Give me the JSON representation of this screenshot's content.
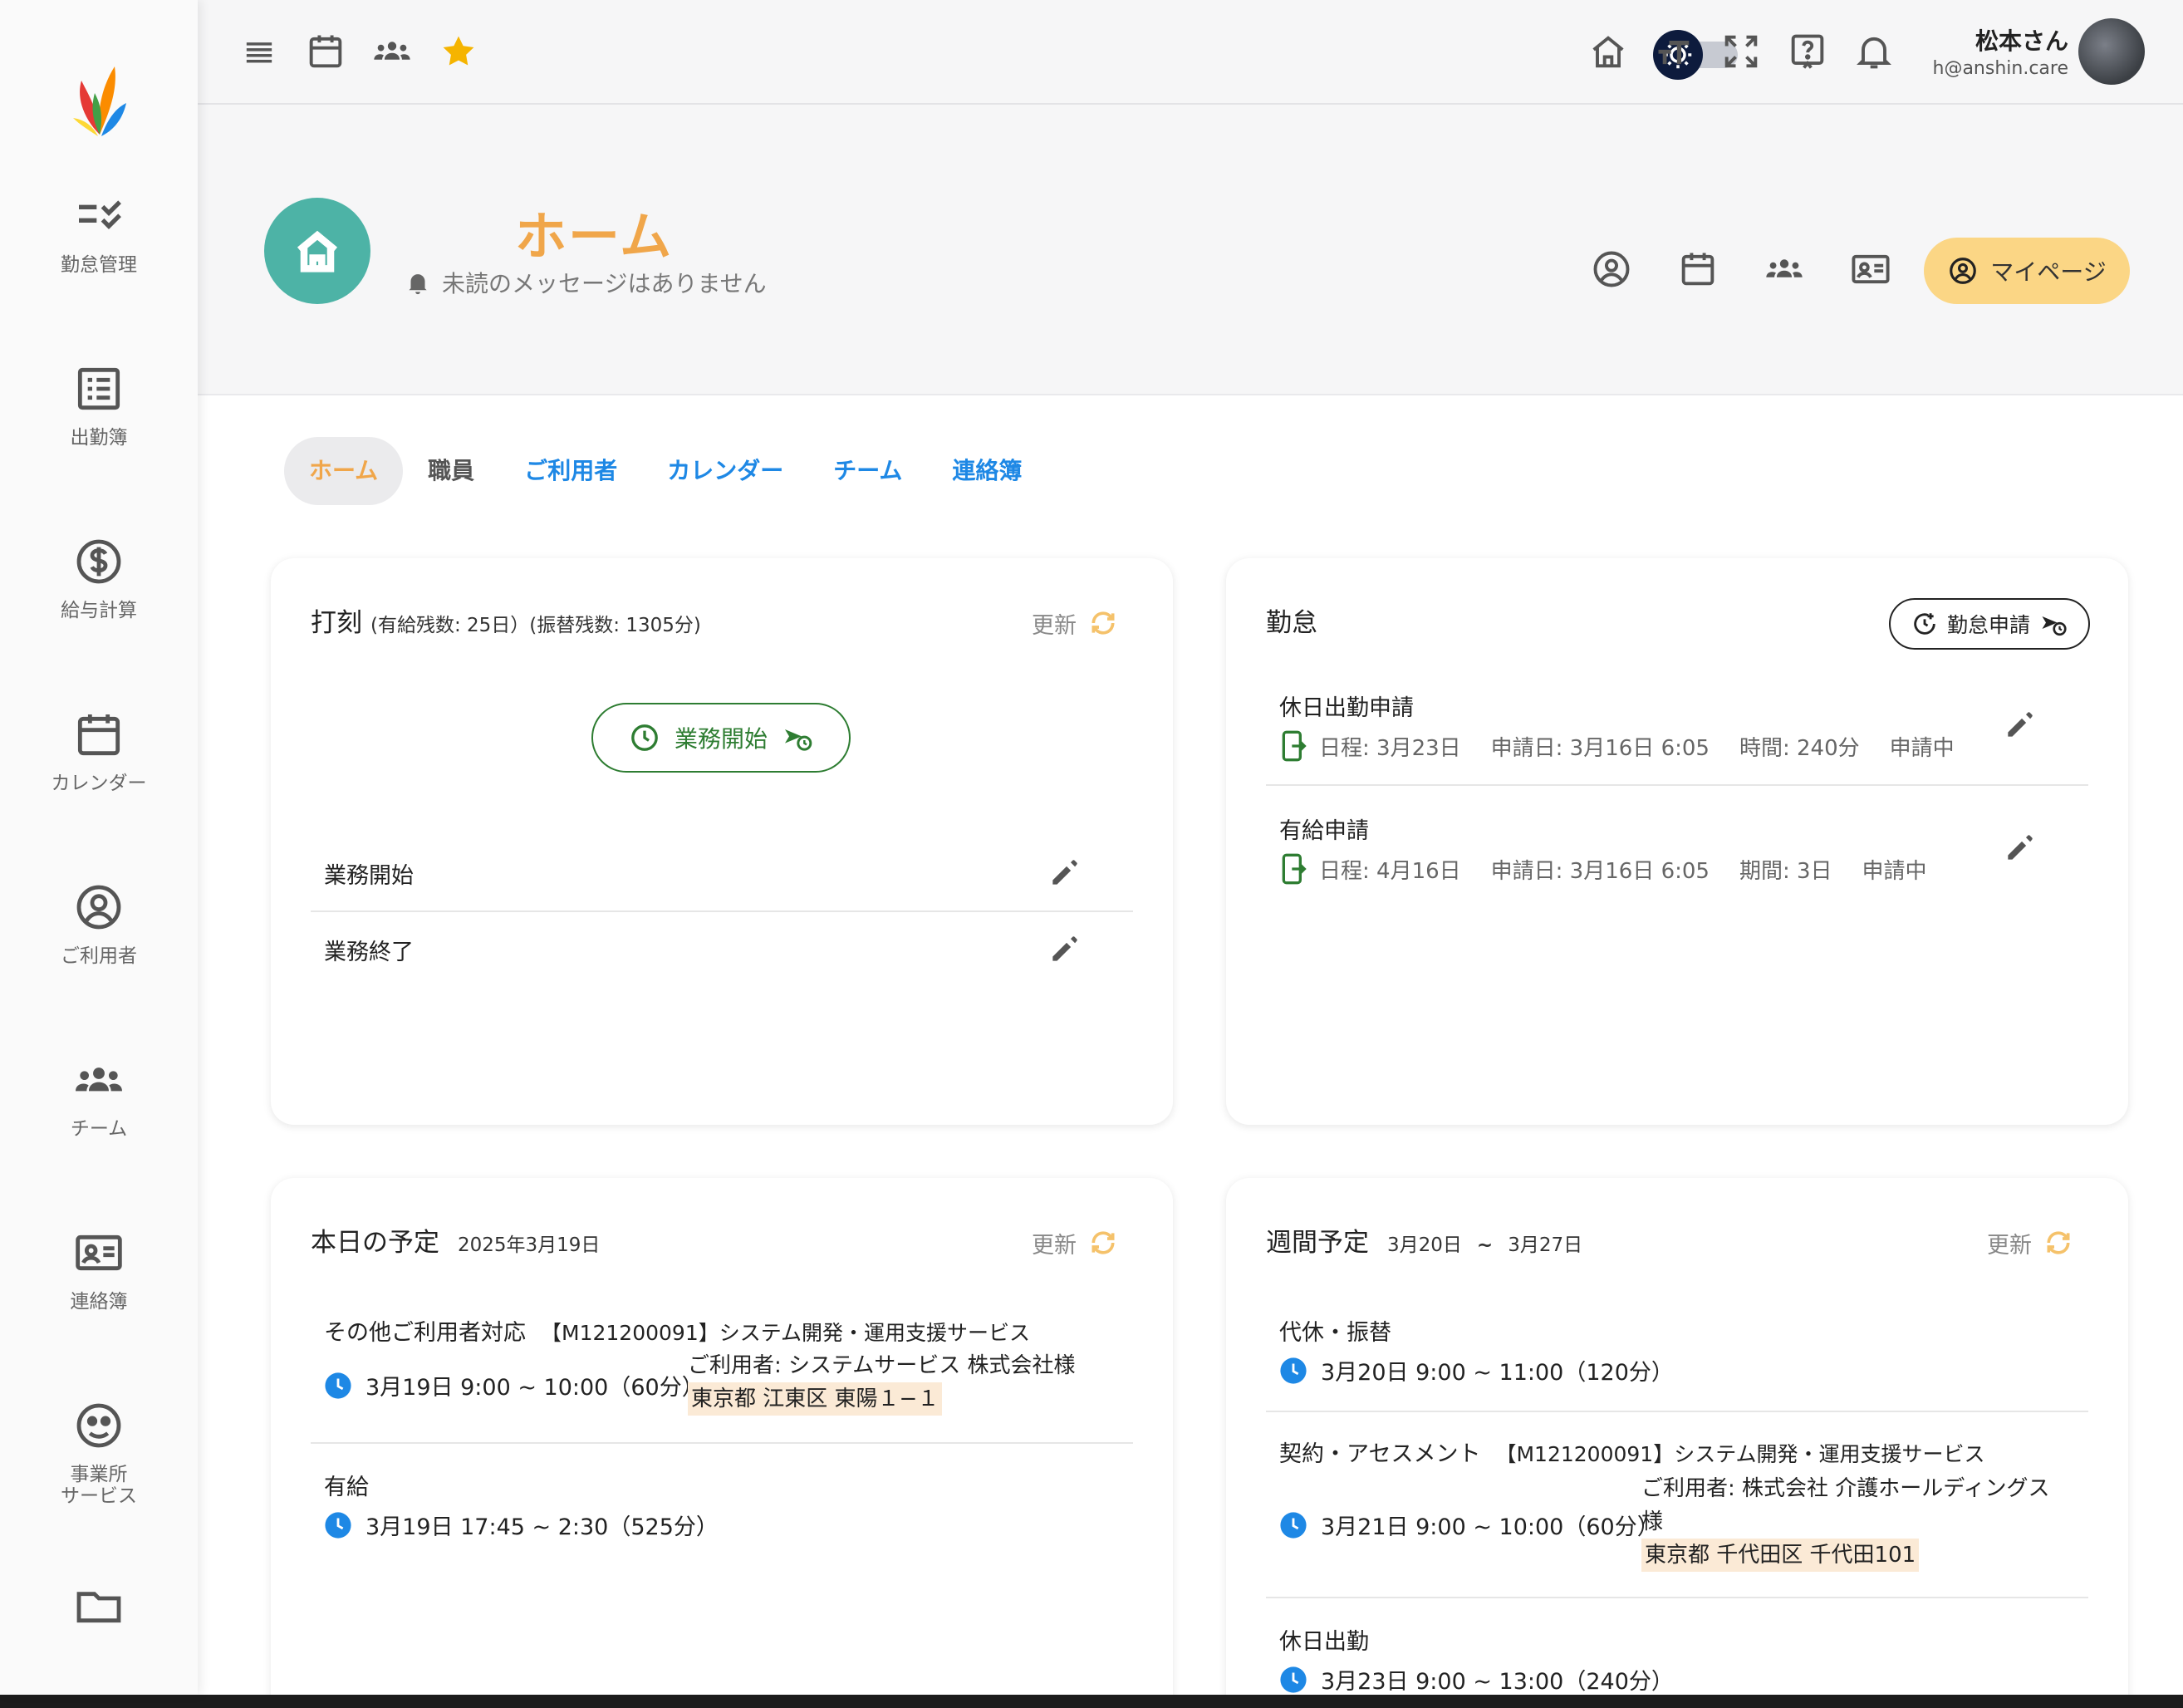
{
  "sidebar": {
    "items": [
      {
        "label": "勤怠管理",
        "icon": "attendance-check-icon"
      },
      {
        "label": "出勤簿",
        "icon": "list-icon"
      },
      {
        "label": "給与計算",
        "icon": "dollar-icon"
      },
      {
        "label": "カレンダー",
        "icon": "calendar-icon"
      },
      {
        "label": "ご利用者",
        "icon": "user-circle-icon"
      },
      {
        "label": "チーム",
        "icon": "team-icon"
      },
      {
        "label": "連絡簿",
        "icon": "contact-card-icon"
      },
      {
        "label": "事業所",
        "label2": "サービス",
        "icon": "face-icon"
      }
    ]
  },
  "topbar": {
    "user_name": "松本さん",
    "user_email": "h@anshin.care"
  },
  "header": {
    "title": "ホーム",
    "unread": "未読のメッセージはありません",
    "mypage_label": "マイページ"
  },
  "tabs": [
    {
      "label": "ホーム"
    },
    {
      "label": "職員"
    },
    {
      "label": "ご利用者"
    },
    {
      "label": "カレンダー"
    },
    {
      "label": "チーム"
    },
    {
      "label": "連絡簿"
    }
  ],
  "punch": {
    "title": "打刻",
    "sub": "(有給残数: 25日）(振替残数: 1305分)",
    "refresh": "更新",
    "start_button": "業務開始",
    "rows": [
      {
        "label": "業務開始"
      },
      {
        "label": "業務終了"
      }
    ]
  },
  "attendance": {
    "title": "勤怠",
    "request_button": "勤怠申請",
    "items": [
      {
        "title": "休日出勤申請",
        "date": "日程: 3月23日",
        "applied": "申請日: 3月16日 6:05",
        "extra": "時間: 240分",
        "status": "申請中"
      },
      {
        "title": "有給申請",
        "date": "日程: 4月16日",
        "applied": "申請日: 3月16日 6:05",
        "extra": "期間: 3日",
        "status": "申請中"
      }
    ]
  },
  "today": {
    "title": "本日の予定",
    "date": "2025年3月19日",
    "refresh": "更新",
    "items": [
      {
        "title": "その他ご利用者対応",
        "code": "【M121200091】システム開発・運用支援サービス",
        "time": "3月19日 9:00 ~ 10:00（60分）",
        "client": "ご利用者: システムサービス 株式会社様",
        "address": "東京都 江東区 東陽１−１"
      },
      {
        "title": "有給",
        "time": "3月19日 17:45 ~ 2:30（525分）"
      }
    ]
  },
  "weekly": {
    "title": "週間予定",
    "from": "3月20日",
    "tilde": "~",
    "to": "3月27日",
    "refresh": "更新",
    "items": [
      {
        "title": "代休・振替",
        "time": "3月20日 9:00 ~ 11:00（120分）"
      },
      {
        "title": "契約・アセスメント",
        "code": "【M121200091】システム開発・運用支援サービス",
        "time": "3月21日 9:00 ~ 10:00（60分）",
        "client1": "ご利用者: 株式会社 介護ホールディングス",
        "client2": "様",
        "address": "東京都 千代田区 千代田101"
      },
      {
        "title": "休日出勤",
        "time": "3月23日 9:00 ~ 13:00（240分）"
      }
    ]
  },
  "colors": {
    "accent_orange": "#f0a64a",
    "teal": "#4db3a6",
    "link_blue": "#1e88e5",
    "green": "#2e7d32",
    "mypage_yellow": "#fbd685",
    "clock_blue": "#1e88e5"
  }
}
